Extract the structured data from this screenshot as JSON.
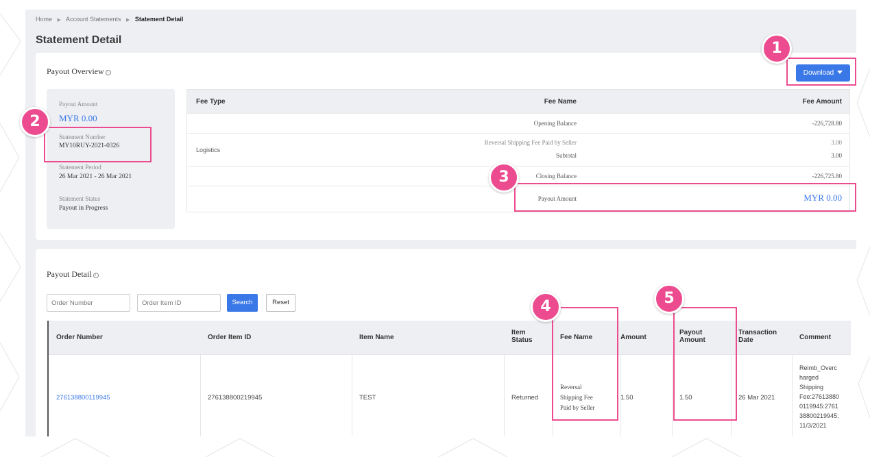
{
  "breadcrumb": {
    "home": "Home",
    "statements": "Account Statements",
    "current": "Statement Detail"
  },
  "page_title": "Statement Detail",
  "overview": {
    "title": "Payout Overview",
    "download_label": "Download",
    "summary": {
      "payout_amount_label": "Payout Amount",
      "payout_amount_value": "MYR 0.00",
      "statement_number_label": "Statement Number",
      "statement_number_value": "MY10RUY-2021-0326",
      "statement_period_label": "Statement Period",
      "statement_period_value": "26 Mar 2021 - 26 Mar 2021",
      "statement_status_label": "Statement Status",
      "statement_status_value": "Payout in Progress"
    },
    "fee_table": {
      "headers": {
        "fee_type": "Fee Type",
        "fee_name": "Fee Name",
        "fee_amount": "Fee Amount"
      },
      "opening_name": "Opening Balance",
      "opening_amount": "-226,728.80",
      "logistics_type": "Logistics",
      "reversal_name": "Reversal Shipping Fee Paid by Seller",
      "reversal_amount": "3.00",
      "subtotal_name": "Subtotal",
      "subtotal_amount": "3.00",
      "closing_name": "Closing Balance",
      "closing_amount": "-226,725.80",
      "payout_name": "Payout Amount",
      "payout_amount": "MYR 0.00"
    }
  },
  "detail": {
    "title": "Payout Detail",
    "order_number_placeholder": "Order Number",
    "order_item_placeholder": "Order Item ID",
    "search_label": "Search",
    "reset_label": "Reset",
    "table": {
      "headers": {
        "order_number": "Order Number",
        "order_item_id": "Order Item ID",
        "item_name": "Item Name",
        "item_status_1": "Item",
        "item_status_2": "Status",
        "fee_name": "Fee Name",
        "amount": "Amount",
        "payout_amount_1": "Payout",
        "payout_amount_2": "Amount",
        "transaction_date_1": "Transaction",
        "transaction_date_2": "Date",
        "comment": "Comment"
      },
      "row": {
        "order_number": "276138800119945",
        "order_item_id": "276138800219945",
        "item_name": "TEST",
        "item_status": "Returned",
        "fee_name_lines": [
          "Reversal",
          "Shipping Fee",
          "Paid by Seller"
        ],
        "amount": "1.50",
        "payout_amount": "1.50",
        "transaction_date": "26 Mar 2021",
        "comment_lines": [
          "Reimb_Overc",
          "harged",
          "Shipping",
          "Fee:27613880",
          "0119945:2761",
          "38800219945;",
          "11/3/2021"
        ]
      }
    }
  },
  "annotations": [
    "1",
    "2",
    "3",
    "4",
    "5"
  ],
  "colors": {
    "accent": "#3b78e7",
    "highlight": "#ec4c8f",
    "panel_bg": "#eeeff3"
  }
}
